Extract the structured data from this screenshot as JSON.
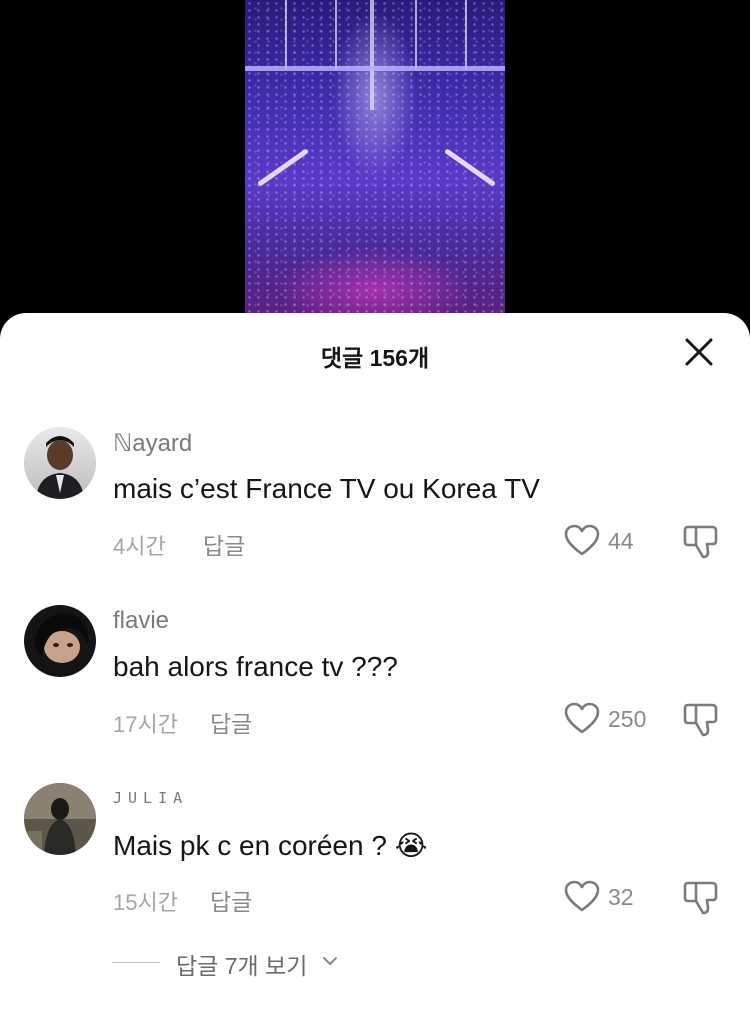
{
  "sheet": {
    "title": "댓글 156개"
  },
  "comments": [
    {
      "username": "ℕayard",
      "text": "mais c’est France TV ou Korea TV",
      "time": "4시간",
      "reply_label": "답글",
      "likes": "44"
    },
    {
      "username": "flavie",
      "text": "bah alors france tv ???",
      "time": "17시간",
      "reply_label": "답글",
      "likes": "250"
    },
    {
      "username": "JULIA",
      "text": "Mais pk c en coréen ? 😭",
      "time": "15시간",
      "reply_label": "답글",
      "likes": "32"
    }
  ],
  "more_replies": {
    "label": "답글 7개 보기"
  },
  "icons": {
    "close": "close-icon",
    "like": "heart-outline-icon",
    "dislike": "thumbs-down-icon",
    "chevron": "chevron-down-icon"
  },
  "colors": {
    "background": "#000000",
    "sheet": "#ffffff",
    "text": "#161616",
    "muted": "#8a8a8a"
  }
}
